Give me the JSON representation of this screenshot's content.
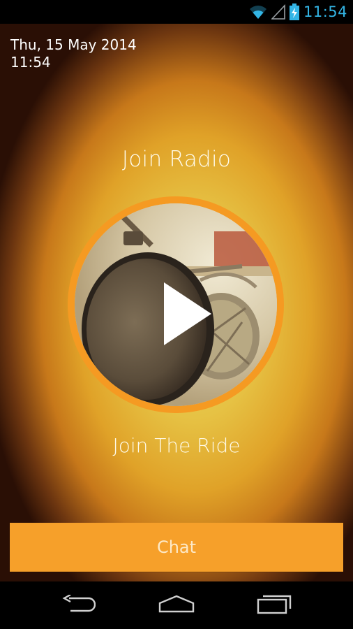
{
  "status_bar": {
    "time": "11:54",
    "icons": [
      "wifi-icon",
      "signal-icon",
      "battery-charging-icon"
    ],
    "accent_color": "#33b5e5"
  },
  "lockscreen": {
    "date": "Thu, 15 May 2014",
    "time": "11:54"
  },
  "main": {
    "title": "Join Radio",
    "play_icon": "play-icon",
    "tagline": "Join The Ride",
    "chat_button_label": "Chat",
    "accent_color": "#f59a22"
  },
  "nav_bar": {
    "items": [
      "back-icon",
      "home-icon",
      "recent-apps-icon"
    ]
  }
}
